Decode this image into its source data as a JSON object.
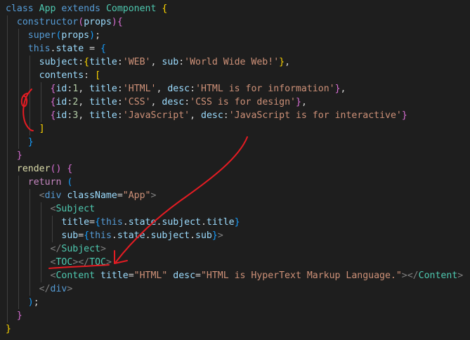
{
  "editor": {
    "colors": {
      "background": "#1e1e1e",
      "keyword": "#569cd6",
      "control": "#c586c0",
      "class": "#4ec9b0",
      "function": "#dcdcaa",
      "variable": "#9cdcfe",
      "string": "#ce9178",
      "number": "#b5cea8",
      "plain": "#d4d4d4",
      "tag": "#4ec9b0",
      "tagBracket": "#808080",
      "brace_gold": "#ffd700",
      "brace_purple": "#da70d6",
      "brace_blue": "#179fff",
      "annotation": "#e51c23"
    },
    "lines": [
      [
        [
          "class ",
          "keyword"
        ],
        [
          "App ",
          "class"
        ],
        [
          "extends ",
          "keyword"
        ],
        [
          "Component ",
          "class"
        ],
        [
          "{",
          "brace_gold"
        ]
      ],
      [
        [
          "  "
        ],
        [
          "constructor",
          "keyword"
        ],
        [
          "(",
          "brace_purple"
        ],
        [
          "props",
          "variable"
        ],
        [
          ")",
          "brace_purple"
        ],
        [
          "{",
          "brace_purple"
        ]
      ],
      [
        [
          "    "
        ],
        [
          "super",
          "keyword"
        ],
        [
          "(",
          "brace_blue"
        ],
        [
          "props",
          "variable"
        ],
        [
          ")",
          "brace_blue"
        ],
        [
          ";"
        ]
      ],
      [
        [
          "    "
        ],
        [
          "this",
          "keyword"
        ],
        [
          "."
        ],
        [
          "state",
          "variable"
        ],
        [
          " = "
        ],
        [
          "{",
          "brace_blue"
        ]
      ],
      [
        [
          "      "
        ],
        [
          "subject",
          "variable"
        ],
        [
          ":"
        ],
        [
          "{",
          "brace_gold"
        ],
        [
          "title",
          "variable"
        ],
        [
          ":"
        ],
        [
          "'WEB'",
          "string"
        ],
        [
          ", "
        ],
        [
          "sub",
          "variable"
        ],
        [
          ":"
        ],
        [
          "'World Wide Web!'",
          "string"
        ],
        [
          "}",
          "brace_gold"
        ],
        [
          ","
        ]
      ],
      [
        [
          "      "
        ],
        [
          "contents",
          "variable"
        ],
        [
          ": "
        ],
        [
          "[",
          "brace_gold"
        ]
      ],
      [
        [
          "        "
        ],
        [
          "{",
          "brace_purple"
        ],
        [
          "id",
          "variable"
        ],
        [
          ":"
        ],
        [
          "1",
          "number"
        ],
        [
          ", "
        ],
        [
          "title",
          "variable"
        ],
        [
          ":"
        ],
        [
          "'HTML'",
          "string"
        ],
        [
          ", "
        ],
        [
          "desc",
          "variable"
        ],
        [
          ":"
        ],
        [
          "'HTML is for information'",
          "string"
        ],
        [
          "}",
          "brace_purple"
        ],
        [
          ","
        ]
      ],
      [
        [
          "        "
        ],
        [
          "{",
          "brace_purple"
        ],
        [
          "id",
          "variable"
        ],
        [
          ":"
        ],
        [
          "2",
          "number"
        ],
        [
          ", "
        ],
        [
          "title",
          "variable"
        ],
        [
          ":"
        ],
        [
          "'CSS'",
          "string"
        ],
        [
          ", "
        ],
        [
          "desc",
          "variable"
        ],
        [
          ":"
        ],
        [
          "'CSS is for design'",
          "string"
        ],
        [
          "}",
          "brace_purple"
        ],
        [
          ","
        ]
      ],
      [
        [
          "        "
        ],
        [
          "{",
          "brace_purple"
        ],
        [
          "id",
          "variable"
        ],
        [
          ":"
        ],
        [
          "3",
          "number"
        ],
        [
          ", "
        ],
        [
          "title",
          "variable"
        ],
        [
          ":"
        ],
        [
          "'JavaScript'",
          "string"
        ],
        [
          ", "
        ],
        [
          "desc",
          "variable"
        ],
        [
          ":"
        ],
        [
          "'JavaScript is for interactive'",
          "string"
        ],
        [
          "}",
          "brace_purple"
        ]
      ],
      [
        [
          "      "
        ],
        [
          "]",
          "brace_gold"
        ]
      ],
      [
        [
          "    "
        ],
        [
          "}",
          "brace_blue"
        ]
      ],
      [
        [
          "  "
        ],
        [
          "}",
          "brace_purple"
        ]
      ],
      [
        [
          "  "
        ],
        [
          "render",
          "function"
        ],
        [
          "() ",
          "brace_purple"
        ],
        [
          "{",
          "brace_purple"
        ]
      ],
      [
        [
          "    "
        ],
        [
          "return ",
          "control"
        ],
        [
          "(",
          "brace_blue"
        ]
      ],
      [
        [
          "      "
        ],
        [
          "<",
          "tagBracket"
        ],
        [
          "div ",
          "keyword"
        ],
        [
          "className",
          "variable"
        ],
        [
          "="
        ],
        [
          "\"App\"",
          "string"
        ],
        [
          ">",
          "tagBracket"
        ]
      ],
      [
        [
          "        "
        ],
        [
          "<",
          "tagBracket"
        ],
        [
          "Subject",
          "tag"
        ]
      ],
      [
        [
          "          "
        ],
        [
          "title",
          "variable"
        ],
        [
          "="
        ],
        [
          "{",
          "brace_blue"
        ],
        [
          "this",
          "keyword"
        ],
        [
          "."
        ],
        [
          "state",
          "variable"
        ],
        [
          "."
        ],
        [
          "subject",
          "variable"
        ],
        [
          "."
        ],
        [
          "title",
          "variable"
        ],
        [
          "}",
          "brace_blue"
        ]
      ],
      [
        [
          "          "
        ],
        [
          "sub",
          "variable"
        ],
        [
          "="
        ],
        [
          "{",
          "brace_blue"
        ],
        [
          "this",
          "keyword"
        ],
        [
          "."
        ],
        [
          "state",
          "variable"
        ],
        [
          "."
        ],
        [
          "subject",
          "variable"
        ],
        [
          "."
        ],
        [
          "sub",
          "variable"
        ],
        [
          "}",
          "brace_blue"
        ],
        [
          ">",
          "tagBracket"
        ]
      ],
      [
        [
          "        "
        ],
        [
          "</",
          "tagBracket"
        ],
        [
          "Subject",
          "tag"
        ],
        [
          ">",
          "tagBracket"
        ]
      ],
      [
        [
          "        "
        ],
        [
          "<",
          "tagBracket"
        ],
        [
          "TOC",
          "tag"
        ],
        [
          "></",
          "tagBracket"
        ],
        [
          "TOC",
          "tag"
        ],
        [
          ">",
          "tagBracket"
        ]
      ],
      [
        [
          "        "
        ],
        [
          "<",
          "tagBracket"
        ],
        [
          "Content ",
          "tag"
        ],
        [
          "title",
          "variable"
        ],
        [
          "="
        ],
        [
          "\"HTML\" ",
          "string"
        ],
        [
          "desc",
          "variable"
        ],
        [
          "="
        ],
        [
          "\"HTML is HyperText Markup Language.\"",
          "string"
        ],
        [
          "></",
          "tagBracket"
        ],
        [
          "Content",
          "tag"
        ],
        [
          ">",
          "tagBracket"
        ]
      ],
      [
        [
          "      "
        ],
        [
          "</",
          "tagBracket"
        ],
        [
          "div",
          "keyword"
        ],
        [
          ">",
          "tagBracket"
        ]
      ],
      [
        [
          "    "
        ],
        [
          ")",
          "brace_blue"
        ],
        [
          ";"
        ]
      ],
      [
        [
          "  "
        ],
        [
          "}",
          "brace_purple"
        ]
      ],
      [
        [
          "}",
          "brace_gold"
        ]
      ]
    ]
  }
}
